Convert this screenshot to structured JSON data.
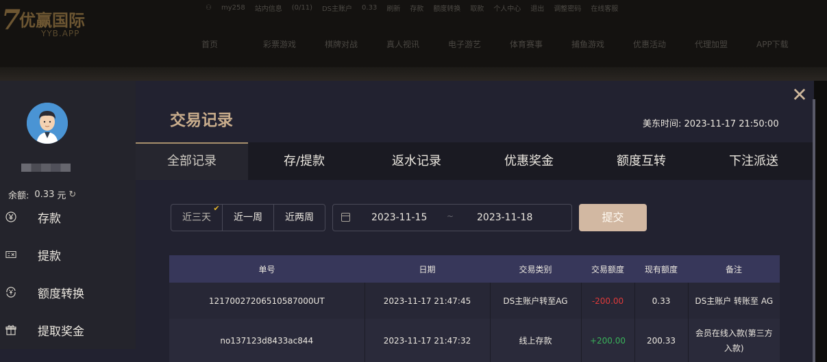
{
  "site": {
    "logo_text": "优赢国际",
    "logo_sub": "YYB.APP",
    "topbar": [
      "my258",
      "站内信息",
      "(0/11)",
      "DS主账户",
      "0.33",
      "刷新",
      "存款",
      "额度转换",
      "取款",
      "个人中心",
      "退出",
      "调整密码",
      "在线客服"
    ],
    "nav": [
      "首页",
      "彩票游戏",
      "棋牌对战",
      "真人视讯",
      "电子游艺",
      "体育赛事",
      "捕鱼游戏",
      "优惠活动",
      "代理加盟",
      "APP下载"
    ]
  },
  "sidebar": {
    "balance_label": "余额:",
    "balance_value": "0.33",
    "balance_unit": "元",
    "refresh_icon": "↻",
    "items": [
      {
        "label": "存款",
        "icon": "deposit-icon",
        "glyph": "¥"
      },
      {
        "label": "提款",
        "icon": "withdraw-icon",
        "glyph": "▭"
      },
      {
        "label": "额度转换",
        "icon": "transfer-icon",
        "glyph": "¥"
      },
      {
        "label": "提取奖金",
        "icon": "gift-icon",
        "glyph": "⌂"
      }
    ]
  },
  "main": {
    "title": "交易记录",
    "time_label": "美东时间:",
    "time_value": "2023-11-17 21:50:00",
    "close_glyph": "✕",
    "tabs": [
      "全部记录",
      "存/提款",
      "返水记录",
      "优惠奖金",
      "额度互转",
      "下注派送"
    ],
    "active_tab": 0,
    "quick_ranges": [
      "近三天",
      "近一周",
      "近两周"
    ],
    "active_range": 0,
    "date_start": "2023-11-15",
    "date_sep": "~",
    "date_end": "2023-11-18",
    "submit_label": "提交"
  },
  "table": {
    "headers": [
      "单号",
      "日期",
      "交易类别",
      "交易额度",
      "现有额度",
      "备注"
    ],
    "rows": [
      [
        "12170027206510587000UT",
        "2023-11-17 21:47:45",
        "DS主账户转至AG",
        "-200.00",
        "0.33",
        "DS主账户 转账至 AG"
      ],
      [
        "no137123d8433ac844",
        "2023-11-17 21:47:32",
        "线上存款",
        "+200.00",
        "200.33",
        "会员在线入款(第三方入款)"
      ]
    ]
  },
  "colors": {
    "accent": "#c9ad8c",
    "submit_bg": "#d2b8a2",
    "negative": "#e03a3a",
    "positive": "#3ab35a",
    "header_row": "#37375a"
  }
}
